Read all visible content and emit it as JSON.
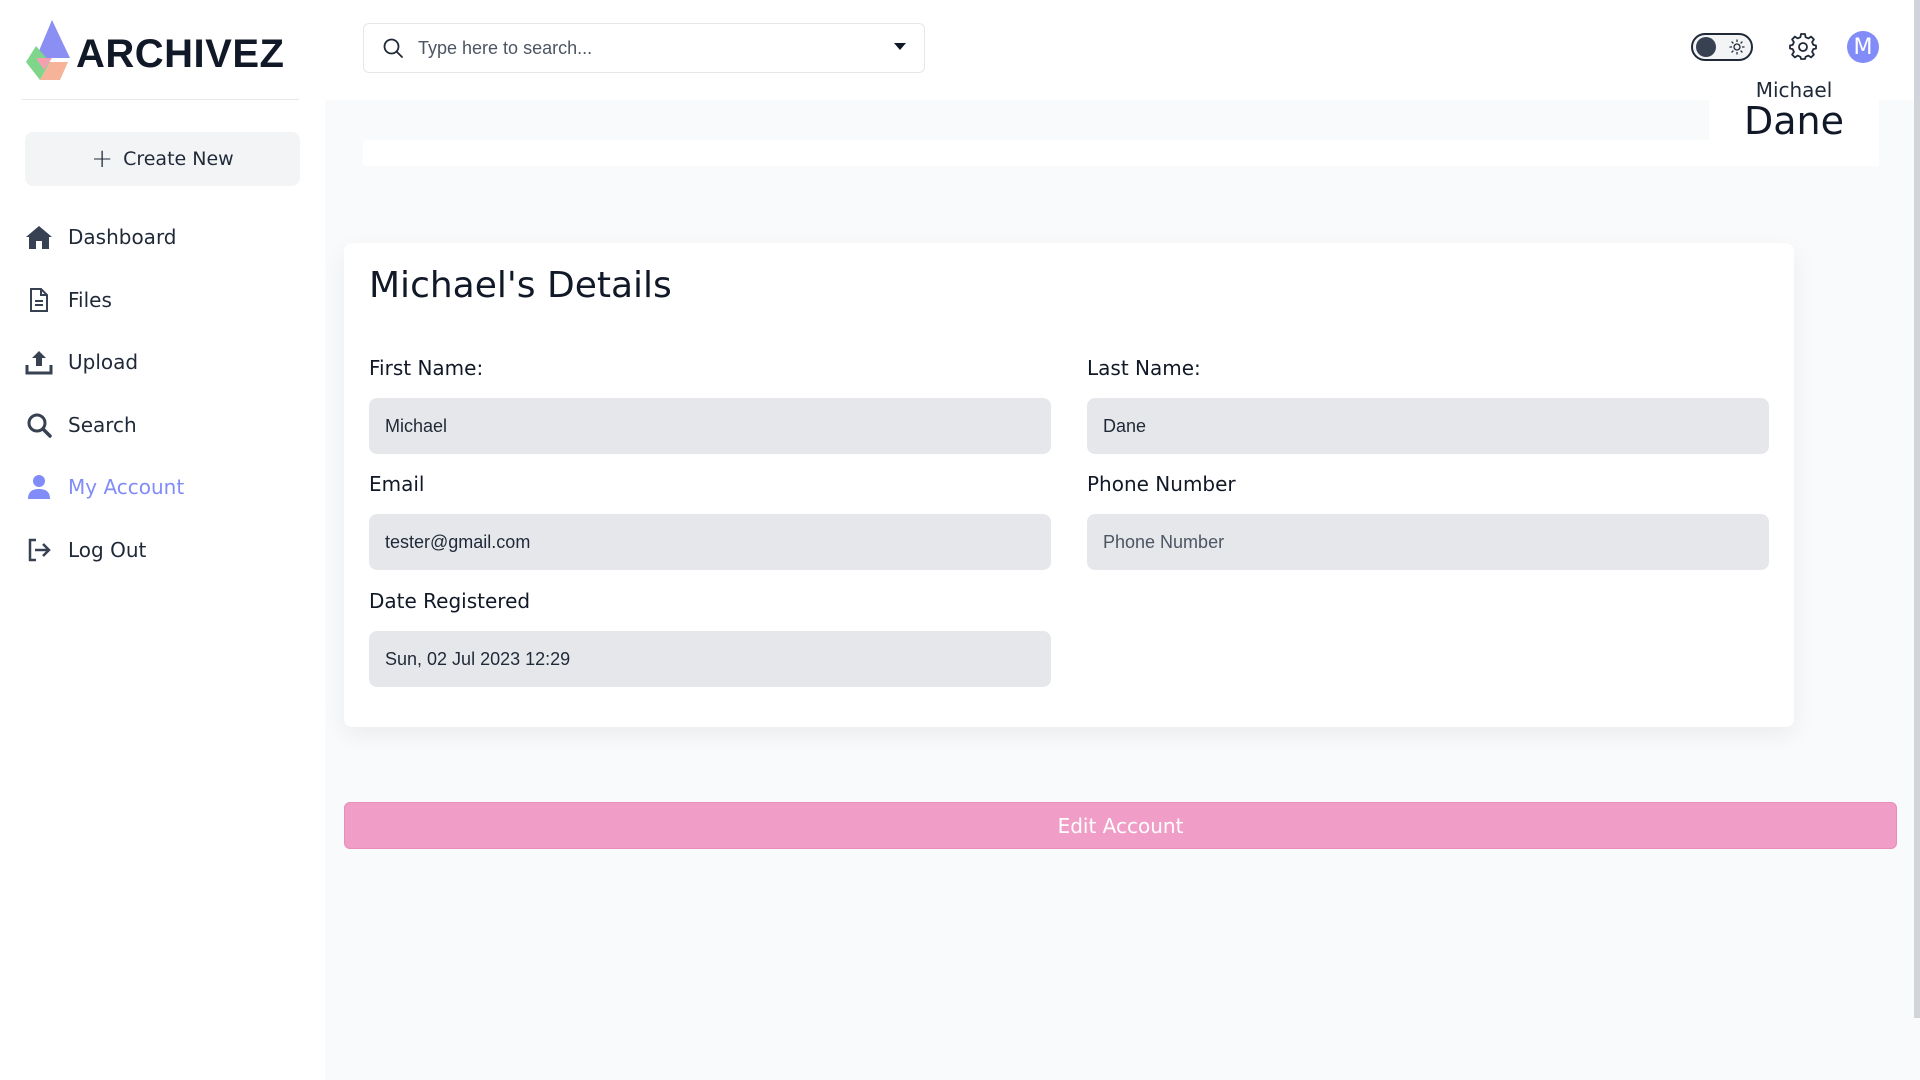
{
  "brand": {
    "name": "ARCHIVEZ"
  },
  "sidebar": {
    "create_label": "Create New",
    "items": [
      {
        "label": "Dashboard",
        "icon": "home-icon"
      },
      {
        "label": "Files",
        "icon": "file-icon"
      },
      {
        "label": "Upload",
        "icon": "upload-icon"
      },
      {
        "label": "Search",
        "icon": "search-icon"
      },
      {
        "label": "My Account",
        "icon": "user-icon",
        "active": true
      },
      {
        "label": "Log Out",
        "icon": "logout-icon"
      }
    ]
  },
  "header": {
    "search_placeholder": "Type here to search...",
    "avatar_initial": "M"
  },
  "profile": {
    "first_name": "Michael",
    "last_name": "Dane"
  },
  "details": {
    "title": "Michael's Details",
    "first_name_label": "First Name:",
    "first_name_value": "Michael",
    "last_name_label": "Last Name:",
    "last_name_value": "Dane",
    "email_label": "Email",
    "email_value": "tester@gmail.com",
    "phone_label": "Phone Number",
    "phone_placeholder": "Phone Number",
    "date_label": "Date Registered",
    "date_value": "Sun, 02 Jul 2023 12:29"
  },
  "edit_label": "Edit Account",
  "colors": {
    "accent": "#818cf8",
    "edit_button": "#f09dc7",
    "field_bg": "#e5e7eb"
  }
}
